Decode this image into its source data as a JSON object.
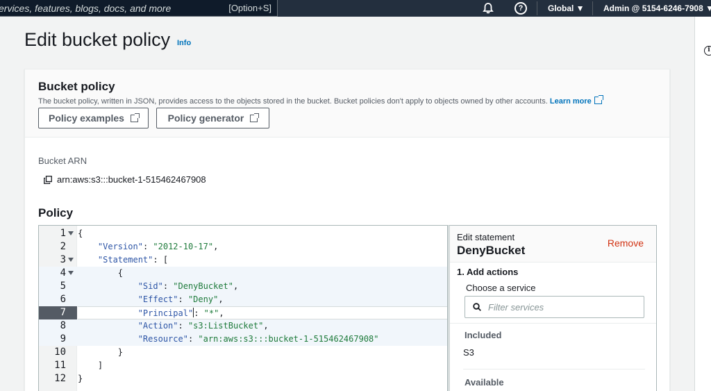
{
  "topnav": {
    "search_placeholder": "ervices, features, blogs, docs, and more",
    "search_shortcut": "[Option+S]",
    "help_glyph": "?",
    "region": "Global ▼",
    "account": "Admin @ 5154-6246-7908 ▼"
  },
  "page": {
    "title": "Edit bucket policy",
    "info_link": "Info"
  },
  "right_rail": {
    "info_glyph": "i"
  },
  "bucket_policy": {
    "title": "Bucket policy",
    "description": "The bucket policy, written in JSON, provides access to the objects stored in the bucket. Bucket policies don't apply to objects owned by other accounts.",
    "learn_more": "Learn more",
    "policy_examples_button": "Policy examples",
    "policy_generator_button": "Policy generator",
    "arn_label": "Bucket ARN",
    "arn_value": "arn:aws:s3:::bucket-1-515462467908",
    "policy_label": "Policy"
  },
  "editor": {
    "line_numbers": [
      "1",
      "2",
      "3",
      "4",
      "5",
      "6",
      "7",
      "8",
      "9",
      "10",
      "11",
      "12"
    ],
    "lines": {
      "l1": {
        "p1": "{"
      },
      "l2": {
        "k": "\"Version\"",
        "p1": ": ",
        "v": "\"2012-10-17\"",
        "p2": ","
      },
      "l3": {
        "k": "\"Statement\"",
        "p1": ": ["
      },
      "l4": {
        "p1": "{"
      },
      "l5": {
        "k": "\"Sid\"",
        "p1": ": ",
        "v": "\"DenyBucket\"",
        "p2": ","
      },
      "l6": {
        "k": "\"Effect\"",
        "p1": ": ",
        "v": "\"Deny\"",
        "p2": ","
      },
      "l7": {
        "k": "\"Principal\"",
        "p1": ": ",
        "v": "\"*\"",
        "p2": ","
      },
      "l8": {
        "k": "\"Action\"",
        "p1": ": ",
        "v": "\"s3:ListBucket\"",
        "p2": ","
      },
      "l9": {
        "k": "\"Resource\"",
        "p1": ": ",
        "v": "\"arn:aws:s3:::bucket-1-515462467908\""
      },
      "l10": {
        "p1": "}"
      },
      "l11": {
        "p1": "]"
      },
      "l12": {
        "p1": "}"
      }
    },
    "active_line": "7"
  },
  "statement_panel": {
    "label": "Edit statement",
    "name": "DenyBucket",
    "remove": "Remove",
    "step": "1. Add actions",
    "choose_service": "Choose a service",
    "filter_placeholder": "Filter services",
    "included_label": "Included",
    "included_value": "S3",
    "available_label": "Available"
  },
  "colors": {
    "nav_bg": "#232f3e",
    "link": "#0073bb",
    "remove": "#d13212",
    "json_key": "#2d55a6",
    "json_string": "#1d7a3a"
  }
}
